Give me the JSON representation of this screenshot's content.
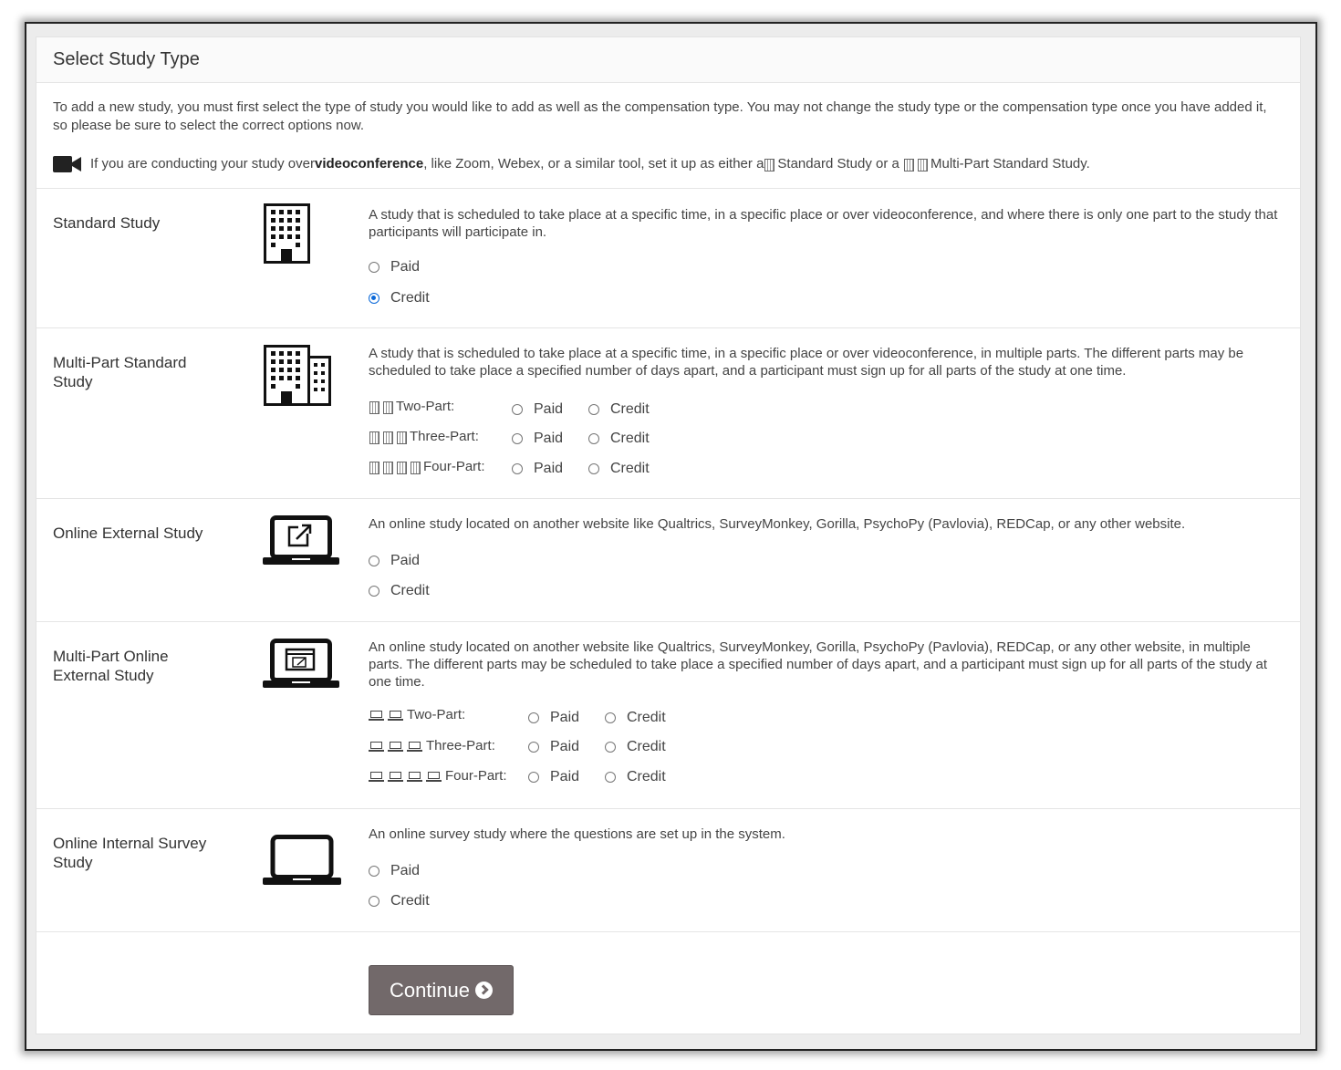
{
  "heading": "Select Study Type",
  "intro": {
    "text": "To add a new study, you must first select the type of study you would like to add as well as the compensation type. You may not change the study type or the compensation type once you have added it, so please be sure to select the correct options now.",
    "video_pre": "If you are conducting your study over ",
    "video_bold": "videoconference",
    "video_mid": ", like Zoom, Webex, or a similar tool, set it up as either a ",
    "video_std": "Standard Study",
    "video_or": " or a ",
    "video_multi": "Multi-Part Standard Study."
  },
  "options": {
    "paid": "Paid",
    "credit": "Credit"
  },
  "standard": {
    "label": "Standard Study",
    "desc": "A study that is scheduled to take place at a specific time, in a specific place or over videoconference, and where there is only one part to the study that participants will participate in.",
    "selected": "credit"
  },
  "multi_standard": {
    "label": "Multi-Part Standard Study",
    "desc": "A study that is scheduled to take place at a specific time, in a specific place or over videoconference, in multiple parts. The different parts may be scheduled to take place a specified number of days apart, and a participant must sign up for all parts of the study at one time.",
    "parts": [
      "Two-Part:",
      "Three-Part:",
      "Four-Part:"
    ]
  },
  "online_external": {
    "label": "Online External Study",
    "desc": "An online study located on another website like Qualtrics, SurveyMonkey, Gorilla, PsychoPy (Pavlovia), REDCap, or any other website."
  },
  "multi_online": {
    "label": "Multi-Part Online External Study",
    "desc": "An online study located on another website like Qualtrics, SurveyMonkey, Gorilla, PsychoPy (Pavlovia), REDCap, or any other website, in multiple parts. The different parts may be scheduled to take place a specified number of days apart, and a participant must sign up for all parts of the study at one time.",
    "parts": [
      "Two-Part:",
      "Three-Part:",
      "Four-Part:"
    ]
  },
  "online_internal": {
    "label": "Online Internal Survey Study",
    "desc": "An online survey study where the questions are set up in the system."
  },
  "continue_label": "Continue",
  "icons": {
    "video": "video-camera-icon",
    "building": "building-icon",
    "buildings": "buildings-icon",
    "laptop_external": "laptop-external-link-icon",
    "laptop_multi": "laptop-window-icon",
    "laptop": "laptop-icon"
  },
  "colors": {
    "radio_selected": "#0a68d8",
    "button_bg": "#72696a"
  }
}
